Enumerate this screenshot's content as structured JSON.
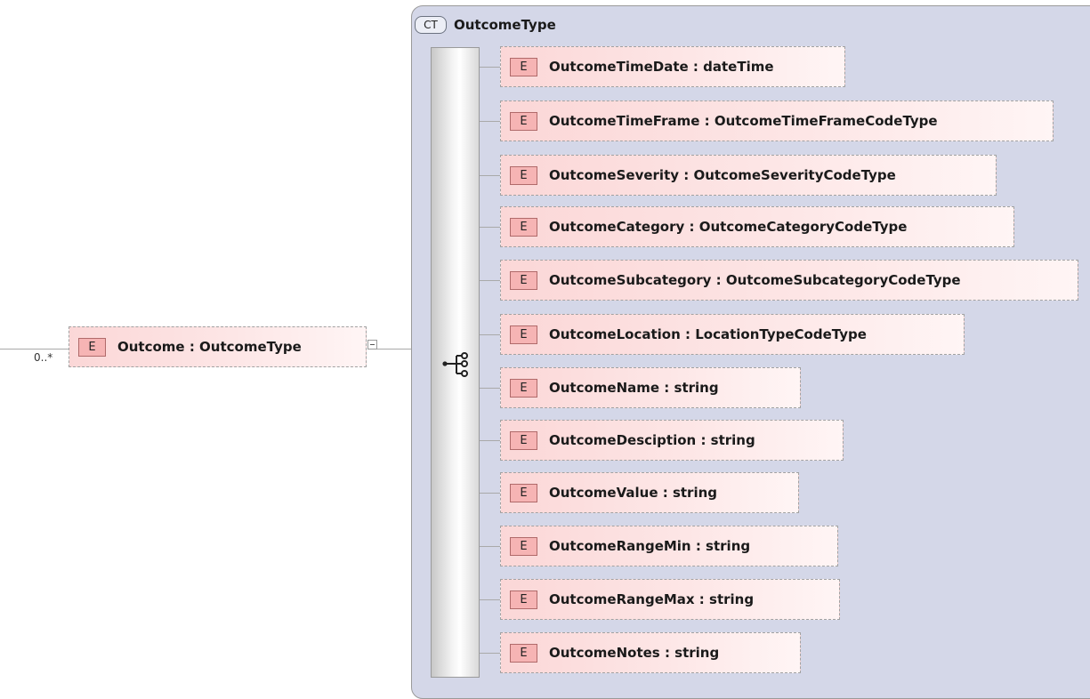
{
  "root": {
    "badge": "E",
    "label": "Outcome : OutcomeType",
    "multiplicity": "0..*"
  },
  "complex_type": {
    "badge": "CT",
    "name": "OutcomeType",
    "compositor_icon": "sequence-icon"
  },
  "elements": [
    {
      "badge": "E",
      "label": "OutcomeTimeDate : dateTime"
    },
    {
      "badge": "E",
      "label": "OutcomeTimeFrame : OutcomeTimeFrameCodeType"
    },
    {
      "badge": "E",
      "label": "OutcomeSeverity : OutcomeSeverityCodeType"
    },
    {
      "badge": "E",
      "label": "OutcomeCategory : OutcomeCategoryCodeType"
    },
    {
      "badge": "E",
      "label": "OutcomeSubcategory : OutcomeSubcategoryCodeType"
    },
    {
      "badge": "E",
      "label": "OutcomeLocation : LocationTypeCodeType"
    },
    {
      "badge": "E",
      "label": "OutcomeName : string"
    },
    {
      "badge": "E",
      "label": "OutcomeDesciption : string"
    },
    {
      "badge": "E",
      "label": "OutcomeValue : string"
    },
    {
      "badge": "E",
      "label": "OutcomeRangeMin : string"
    },
    {
      "badge": "E",
      "label": "OutcomeRangeMax : string"
    },
    {
      "badge": "E",
      "label": "OutcomeNotes : string"
    }
  ]
}
